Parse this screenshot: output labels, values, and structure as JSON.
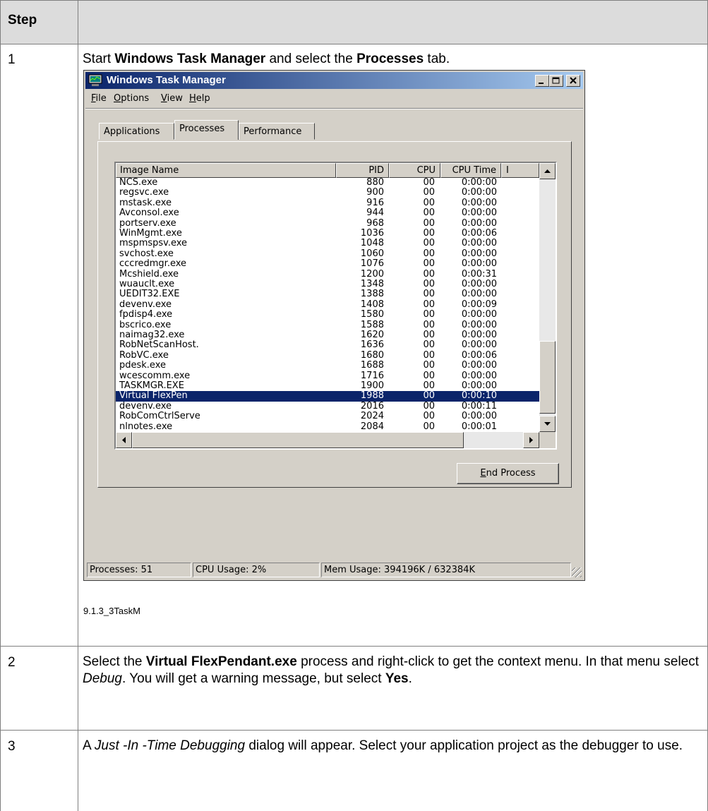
{
  "table": {
    "header_step": "Step",
    "rows": [
      {
        "num": "1",
        "text": {
          "p1": "Start ",
          "b1": "Windows Task Manager",
          "p2": " and select the ",
          "b2": "Processes",
          "p3": " tab."
        },
        "caption": "9.1.3_3TaskM"
      },
      {
        "num": "2",
        "text": {
          "p1": "Select the ",
          "b1": "Virtual FlexPendant.exe",
          "p2": " process and right-click to get the context menu. In that menu select ",
          "i1": "Debug",
          "p3": ". You will get a warning message, but select ",
          "b2": "Yes",
          "p4": "."
        }
      },
      {
        "num": "3",
        "text": {
          "p1": "A ",
          "i1": "Just -In -Time Debugging",
          "p2": "  dialog will appear. Select your application project as the debugger to use."
        }
      }
    ]
  },
  "taskmgr": {
    "title": "Windows Task Manager",
    "menu": [
      {
        "key": "F",
        "rest": "ile"
      },
      {
        "key": "O",
        "rest": "ptions"
      },
      {
        "key": "V",
        "rest": "iew"
      },
      {
        "key": "H",
        "rest": "elp"
      }
    ],
    "tabs": [
      "Applications",
      "Processes",
      "Performance"
    ],
    "active_tab": "Processes",
    "columns": [
      "Image Name",
      "PID",
      "CPU",
      "CPU Time",
      "I"
    ],
    "processes": [
      {
        "name": "NCS.exe",
        "pid": "880",
        "cpu": "00",
        "time": "0:00:00"
      },
      {
        "name": "regsvc.exe",
        "pid": "900",
        "cpu": "00",
        "time": "0:00:00"
      },
      {
        "name": "mstask.exe",
        "pid": "916",
        "cpu": "00",
        "time": "0:00:00"
      },
      {
        "name": "Avconsol.exe",
        "pid": "944",
        "cpu": "00",
        "time": "0:00:00"
      },
      {
        "name": "portserv.exe",
        "pid": "968",
        "cpu": "00",
        "time": "0:00:00"
      },
      {
        "name": "WinMgmt.exe",
        "pid": "1036",
        "cpu": "00",
        "time": "0:00:06"
      },
      {
        "name": "mspmspsv.exe",
        "pid": "1048",
        "cpu": "00",
        "time": "0:00:00"
      },
      {
        "name": "svchost.exe",
        "pid": "1060",
        "cpu": "00",
        "time": "0:00:00"
      },
      {
        "name": "cccredmgr.exe",
        "pid": "1076",
        "cpu": "00",
        "time": "0:00:00"
      },
      {
        "name": "Mcshield.exe",
        "pid": "1200",
        "cpu": "00",
        "time": "0:00:31"
      },
      {
        "name": "wuauclt.exe",
        "pid": "1348",
        "cpu": "00",
        "time": "0:00:00"
      },
      {
        "name": "UEDIT32.EXE",
        "pid": "1388",
        "cpu": "00",
        "time": "0:00:00"
      },
      {
        "name": "devenv.exe",
        "pid": "1408",
        "cpu": "00",
        "time": "0:00:09"
      },
      {
        "name": "fpdisp4.exe",
        "pid": "1580",
        "cpu": "00",
        "time": "0:00:00"
      },
      {
        "name": "bscrico.exe",
        "pid": "1588",
        "cpu": "00",
        "time": "0:00:00"
      },
      {
        "name": "naimag32.exe",
        "pid": "1620",
        "cpu": "00",
        "time": "0:00:00"
      },
      {
        "name": "RobNetScanHost.",
        "pid": "1636",
        "cpu": "00",
        "time": "0:00:00"
      },
      {
        "name": "RobVC.exe",
        "pid": "1680",
        "cpu": "00",
        "time": "0:00:06"
      },
      {
        "name": "pdesk.exe",
        "pid": "1688",
        "cpu": "00",
        "time": "0:00:00"
      },
      {
        "name": "wcescomm.exe",
        "pid": "1716",
        "cpu": "00",
        "time": "0:00:00"
      },
      {
        "name": "TASKMGR.EXE",
        "pid": "1900",
        "cpu": "00",
        "time": "0:00:00"
      },
      {
        "name": "Virtual FlexPen",
        "pid": "1988",
        "cpu": "00",
        "time": "0:00:10",
        "selected": true
      },
      {
        "name": "devenv.exe",
        "pid": "2016",
        "cpu": "00",
        "time": "0:00:11"
      },
      {
        "name": "RobComCtrlServe",
        "pid": "2024",
        "cpu": "00",
        "time": "0:00:00"
      },
      {
        "name": "nlnotes.exe",
        "pid": "2084",
        "cpu": "00",
        "time": "0:00:01"
      }
    ],
    "end_process_key": "E",
    "end_process_rest": "nd Process",
    "status": {
      "processes": "Processes: 51",
      "cpu": "CPU Usage: 2%",
      "mem": "Mem Usage: 394196K / 632384K"
    },
    "colors": {
      "title_start": "#0a246a",
      "title_end": "#a6caf0",
      "selection": "#0a246a",
      "face": "#d4d0c8"
    }
  }
}
